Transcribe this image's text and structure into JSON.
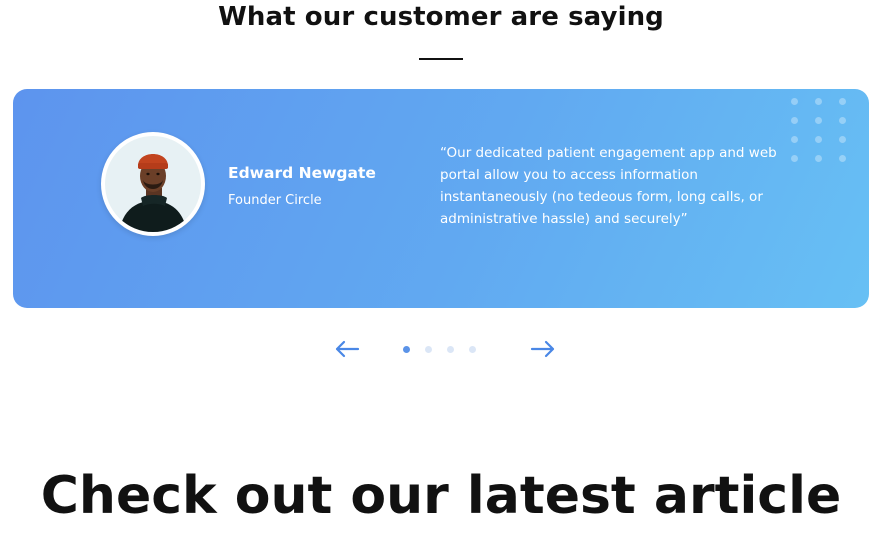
{
  "testimonials_section": {
    "title": "What our customer are saying"
  },
  "testimonial": {
    "name": "Edward Newgate",
    "role": "Founder Circle",
    "quote": "“Our dedicated patient engagement app and web portal allow you to access information instantaneously (no tedeous form, long calls, or administrative hassle) and securely”",
    "avatar_icon": "person-photo"
  },
  "slider": {
    "prev_icon": "arrow-left-icon",
    "next_icon": "arrow-right-icon",
    "slide_count": 4,
    "active_slide": 1
  },
  "articles_section": {
    "title": "Check out our latest article"
  },
  "colors": {
    "card_gradient_start": "#5d94ee",
    "card_gradient_end": "#67c0f4",
    "accent": "#5b93e8",
    "text_dark": "#111111"
  }
}
